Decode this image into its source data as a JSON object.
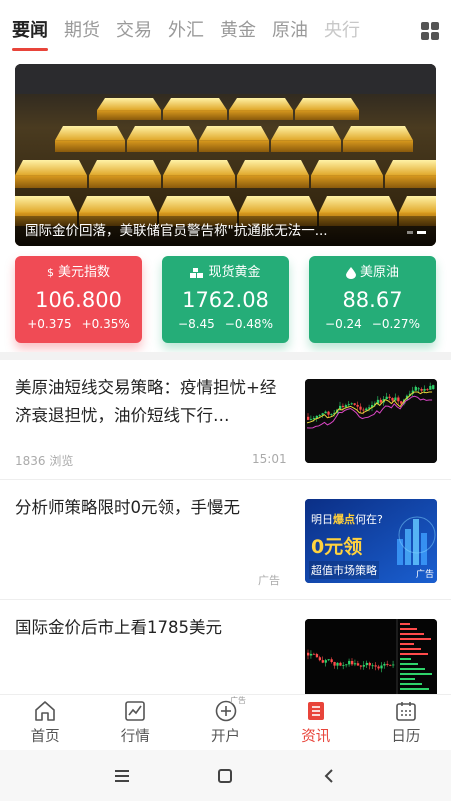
{
  "tabs": [
    {
      "label": "要闻",
      "active": true
    },
    {
      "label": "期货"
    },
    {
      "label": "交易"
    },
    {
      "label": "外汇"
    },
    {
      "label": "黄金"
    },
    {
      "label": "原油"
    },
    {
      "label": "央行"
    }
  ],
  "banner": {
    "caption": "国际金价回落，美联储官员警告称\"抗通胀无法一...",
    "slide_count": 2,
    "active_slide": 2
  },
  "quotes": [
    {
      "icon": "dollar-icon",
      "name": "美元指数",
      "price": "106.800",
      "change": "+0.375",
      "change_pct": "+0.35%",
      "color": "#f04b55"
    },
    {
      "icon": "gold-bars-icon",
      "name": "现货黄金",
      "price": "1762.08",
      "change": "−8.45",
      "change_pct": "−0.48%",
      "color": "#25ad78"
    },
    {
      "icon": "oil-drop-icon",
      "name": "美原油",
      "price": "88.67",
      "change": "−0.24",
      "change_pct": "−0.27%",
      "color": "#25ad78"
    }
  ],
  "news": [
    {
      "title": "美原油短线交易策略：疫情担忧+经济衰退担忧，油价短线下行…",
      "views": "1836 浏览",
      "time": "15:01"
    },
    {
      "title": "分析师策略限时0元领，手慢无",
      "ad_label": "广告",
      "thumb_text": {
        "line1a": "明日",
        "line1b": "爆点",
        "line1c": "何在?",
        "big": "0元领",
        "sub": "超值市场策略",
        "tag": "广告"
      }
    },
    {
      "title": "国际金价后市上看1785美元"
    }
  ],
  "bottom_nav": [
    {
      "label": "首页",
      "icon": "home-icon"
    },
    {
      "label": "行情",
      "icon": "chart-icon"
    },
    {
      "label": "开户",
      "icon": "plus-circle-icon",
      "badge": "广告"
    },
    {
      "label": "资讯",
      "icon": "news-icon",
      "active": true
    },
    {
      "label": "日历",
      "icon": "calendar-icon"
    }
  ],
  "colors": {
    "accent": "#e8443a",
    "up": "#f04b55",
    "down": "#25ad78"
  }
}
